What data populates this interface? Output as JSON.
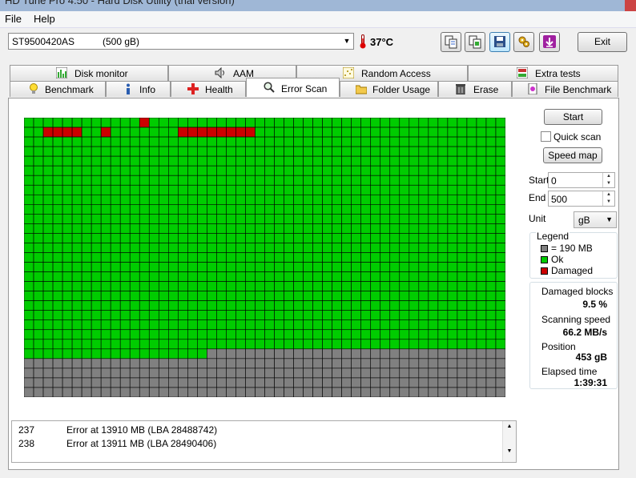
{
  "window": {
    "title": "HD Tune Pro 4.50 - Hard Disk Utility (trial version)"
  },
  "menu": {
    "file": "File",
    "help": "Help"
  },
  "drive": {
    "name": "ST9500420AS",
    "capacity": "(500 gB)"
  },
  "temperature": "37°C",
  "toolbar": {
    "exit_label": "Exit"
  },
  "tabs_top": [
    "Disk monitor",
    "AAM",
    "Random Access",
    "Extra tests"
  ],
  "tabs_bottom": [
    "Benchmark",
    "Info",
    "Health",
    "Error Scan",
    "Folder Usage",
    "Erase",
    "File Benchmark"
  ],
  "active_tab": "Error Scan",
  "controls": {
    "start_button": "Start",
    "quick_scan_label": "Quick scan",
    "quick_scan_checked": false,
    "speed_map_button": "Speed map",
    "start_label": "Start",
    "start_value": "0",
    "end_label": "End",
    "end_value": "500",
    "unit_label": "Unit",
    "unit_value": "gB"
  },
  "legend": {
    "title": "Legend",
    "block_size": "= 190 MB",
    "ok": "Ok",
    "damaged": "Damaged",
    "colors": {
      "unscanned": "#808080",
      "ok": "#00cc00",
      "damaged": "#cc0000"
    }
  },
  "stats": {
    "damaged_blocks_label": "Damaged blocks",
    "damaged_blocks_value": "9.5 %",
    "scanning_speed_label": "Scanning speed",
    "scanning_speed_value": "66.2 MB/s",
    "position_label": "Position",
    "position_value": "453 gB",
    "elapsed_label": "Elapsed time",
    "elapsed_value": "1:39:31"
  },
  "scan_map": {
    "columns": 50,
    "rows": 29,
    "scanned_blocks": 1219,
    "damaged_blocks": [
      [
        0,
        12
      ],
      [
        1,
        2
      ],
      [
        1,
        3
      ],
      [
        1,
        4
      ],
      [
        1,
        5
      ],
      [
        1,
        8
      ],
      [
        1,
        16
      ],
      [
        1,
        17
      ],
      [
        1,
        18
      ],
      [
        1,
        19
      ],
      [
        1,
        20
      ],
      [
        1,
        21
      ],
      [
        1,
        22
      ],
      [
        1,
        23
      ]
    ]
  },
  "log": [
    {
      "n": "237",
      "msg": "Error at 13910 MB (LBA 28488742)"
    },
    {
      "n": "238",
      "msg": "Error at 13911 MB (LBA 28490406)"
    }
  ]
}
